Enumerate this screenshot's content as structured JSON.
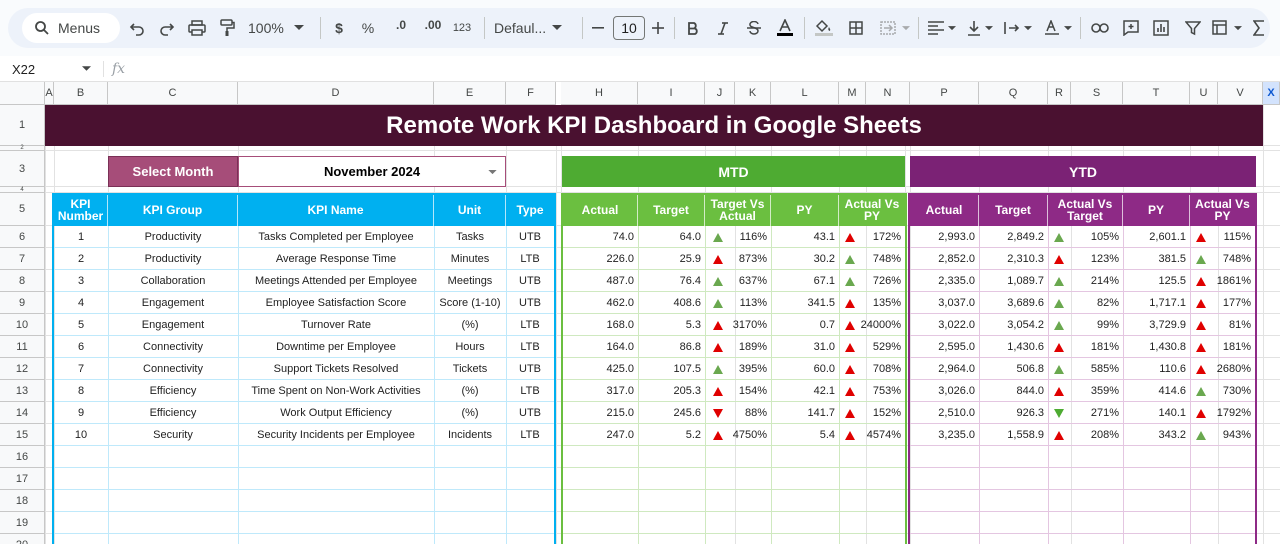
{
  "toolbar": {
    "menus_label": "Menus",
    "zoom": "100%",
    "currency_symbol": "$",
    "percent_symbol": "%",
    "dec_decrease": ".0",
    "dec_increase": ".00",
    "number_format": "123",
    "font_family": "Defaul...",
    "font_size": "10"
  },
  "formula_bar": {
    "cell_ref": "X22",
    "fx": "fx"
  },
  "columns": [
    "A",
    "B",
    "C",
    "D",
    "E",
    "F",
    "H",
    "I",
    "J",
    "K",
    "L",
    "M",
    "N",
    "P",
    "Q",
    "R",
    "S",
    "T",
    "U",
    "V",
    "X"
  ],
  "rows": [
    "1",
    "2",
    "3",
    "4",
    "5",
    "6",
    "7",
    "8",
    "9",
    "10",
    "11",
    "12",
    "13",
    "14",
    "15",
    "16",
    "17",
    "18",
    "19",
    "20"
  ],
  "dashboard": {
    "title": "Remote Work KPI Dashboard in Google Sheets",
    "select_month_label": "Select Month",
    "select_month_value": "November 2024",
    "mtd_label": "MTD",
    "ytd_label": "YTD"
  },
  "headers": {
    "kpi_number": "KPI Number",
    "kpi_group": "KPI Group",
    "kpi_name": "KPI Name",
    "unit": "Unit",
    "type": "Type",
    "mtd_actual": "Actual",
    "mtd_target": "Target",
    "mtd_tva": "Target Vs Actual",
    "mtd_py": "PY",
    "mtd_avp": "Actual Vs PY",
    "ytd_actual": "Actual",
    "ytd_target": "Target",
    "ytd_avt": "Actual Vs Target",
    "ytd_py": "PY",
    "ytd_avp": "Actual Vs PY"
  },
  "colors": {
    "up_green": "#6aa84f",
    "up_red": "#e00000",
    "down_red": "#e00000",
    "down_green": "#4eab32"
  },
  "kpis": [
    {
      "no": "1",
      "group": "Productivity",
      "name": "Tasks Completed per Employee",
      "unit": "Tasks",
      "type": "UTB",
      "mtd_actual": "74.0",
      "mtd_target": "64.0",
      "mtd_tva": "116%",
      "mtd_tva_icon": "up-green",
      "mtd_py": "43.1",
      "mtd_avp": "172%",
      "mtd_avp_icon": "up-red",
      "ytd_actual": "2,993.0",
      "ytd_target": "2,849.2",
      "ytd_avt": "105%",
      "ytd_avt_icon": "up-green",
      "ytd_py": "2,601.1",
      "ytd_avp": "115%",
      "ytd_avp_icon": "up-red"
    },
    {
      "no": "2",
      "group": "Productivity",
      "name": "Average Response Time",
      "unit": "Minutes",
      "type": "LTB",
      "mtd_actual": "226.0",
      "mtd_target": "25.9",
      "mtd_tva": "873%",
      "mtd_tva_icon": "up-red",
      "mtd_py": "30.2",
      "mtd_avp": "748%",
      "mtd_avp_icon": "up-green",
      "ytd_actual": "2,852.0",
      "ytd_target": "2,310.3",
      "ytd_avt": "123%",
      "ytd_avt_icon": "up-red",
      "ytd_py": "381.5",
      "ytd_avp": "748%",
      "ytd_avp_icon": "up-green"
    },
    {
      "no": "3",
      "group": "Collaboration",
      "name": "Meetings Attended per Employee",
      "unit": "Meetings",
      "type": "UTB",
      "mtd_actual": "487.0",
      "mtd_target": "76.4",
      "mtd_tva": "637%",
      "mtd_tva_icon": "up-green",
      "mtd_py": "67.1",
      "mtd_avp": "726%",
      "mtd_avp_icon": "up-green",
      "ytd_actual": "2,335.0",
      "ytd_target": "1,089.7",
      "ytd_avt": "214%",
      "ytd_avt_icon": "up-green",
      "ytd_py": "125.5",
      "ytd_avp": "1861%",
      "ytd_avp_icon": "up-red"
    },
    {
      "no": "4",
      "group": "Engagement",
      "name": "Employee Satisfaction Score",
      "unit": "Score (1-10)",
      "type": "UTB",
      "mtd_actual": "462.0",
      "mtd_target": "408.6",
      "mtd_tva": "113%",
      "mtd_tva_icon": "up-green",
      "mtd_py": "341.5",
      "mtd_avp": "135%",
      "mtd_avp_icon": "up-red",
      "ytd_actual": "3,037.0",
      "ytd_target": "3,689.6",
      "ytd_avt": "82%",
      "ytd_avt_icon": "up-green",
      "ytd_py": "1,717.1",
      "ytd_avp": "177%",
      "ytd_avp_icon": "up-red"
    },
    {
      "no": "5",
      "group": "Engagement",
      "name": "Turnover Rate",
      "unit": "(%)",
      "type": "LTB",
      "mtd_actual": "168.0",
      "mtd_target": "5.3",
      "mtd_tva": "3170%",
      "mtd_tva_icon": "up-red",
      "mtd_py": "0.7",
      "mtd_avp": "24000%",
      "mtd_avp_icon": "up-red",
      "ytd_actual": "3,022.0",
      "ytd_target": "3,054.2",
      "ytd_avt": "99%",
      "ytd_avt_icon": "up-green",
      "ytd_py": "3,729.9",
      "ytd_avp": "81%",
      "ytd_avp_icon": "up-red"
    },
    {
      "no": "6",
      "group": "Connectivity",
      "name": "Downtime per Employee",
      "unit": "Hours",
      "type": "LTB",
      "mtd_actual": "164.0",
      "mtd_target": "86.8",
      "mtd_tva": "189%",
      "mtd_tva_icon": "up-red",
      "mtd_py": "31.0",
      "mtd_avp": "529%",
      "mtd_avp_icon": "up-red",
      "ytd_actual": "2,595.0",
      "ytd_target": "1,430.6",
      "ytd_avt": "181%",
      "ytd_avt_icon": "up-red",
      "ytd_py": "1,430.8",
      "ytd_avp": "181%",
      "ytd_avp_icon": "up-red"
    },
    {
      "no": "7",
      "group": "Connectivity",
      "name": "Support Tickets Resolved",
      "unit": "Tickets",
      "type": "UTB",
      "mtd_actual": "425.0",
      "mtd_target": "107.5",
      "mtd_tva": "395%",
      "mtd_tva_icon": "up-green",
      "mtd_py": "60.0",
      "mtd_avp": "708%",
      "mtd_avp_icon": "up-red",
      "ytd_actual": "2,964.0",
      "ytd_target": "506.8",
      "ytd_avt": "585%",
      "ytd_avt_icon": "up-green",
      "ytd_py": "110.6",
      "ytd_avp": "2680%",
      "ytd_avp_icon": "up-red"
    },
    {
      "no": "8",
      "group": "Efficiency",
      "name": "Time Spent on Non-Work Activities",
      "unit": "(%)",
      "type": "LTB",
      "mtd_actual": "317.0",
      "mtd_target": "205.3",
      "mtd_tva": "154%",
      "mtd_tva_icon": "up-red",
      "mtd_py": "42.1",
      "mtd_avp": "753%",
      "mtd_avp_icon": "up-red",
      "ytd_actual": "3,026.0",
      "ytd_target": "844.0",
      "ytd_avt": "359%",
      "ytd_avt_icon": "up-red",
      "ytd_py": "414.6",
      "ytd_avp": "730%",
      "ytd_avp_icon": "up-green"
    },
    {
      "no": "9",
      "group": "Efficiency",
      "name": "Work Output Efficiency",
      "unit": "(%)",
      "type": "UTB",
      "mtd_actual": "215.0",
      "mtd_target": "245.6",
      "mtd_tva": "88%",
      "mtd_tva_icon": "down-red",
      "mtd_py": "141.7",
      "mtd_avp": "152%",
      "mtd_avp_icon": "up-red",
      "ytd_actual": "2,510.0",
      "ytd_target": "926.3",
      "ytd_avt": "271%",
      "ytd_avt_icon": "down-green",
      "ytd_py": "140.1",
      "ytd_avp": "1792%",
      "ytd_avp_icon": "up-red"
    },
    {
      "no": "10",
      "group": "Security",
      "name": "Security Incidents per Employee",
      "unit": "Incidents",
      "type": "LTB",
      "mtd_actual": "247.0",
      "mtd_target": "5.2",
      "mtd_tva": "4750%",
      "mtd_tva_icon": "up-red",
      "mtd_py": "5.4",
      "mtd_avp": "4574%",
      "mtd_avp_icon": "up-red",
      "ytd_actual": "3,235.0",
      "ytd_target": "1,558.9",
      "ytd_avt": "208%",
      "ytd_avt_icon": "up-red",
      "ytd_py": "343.2",
      "ytd_avp": "943%",
      "ytd_avp_icon": "up-green"
    }
  ]
}
